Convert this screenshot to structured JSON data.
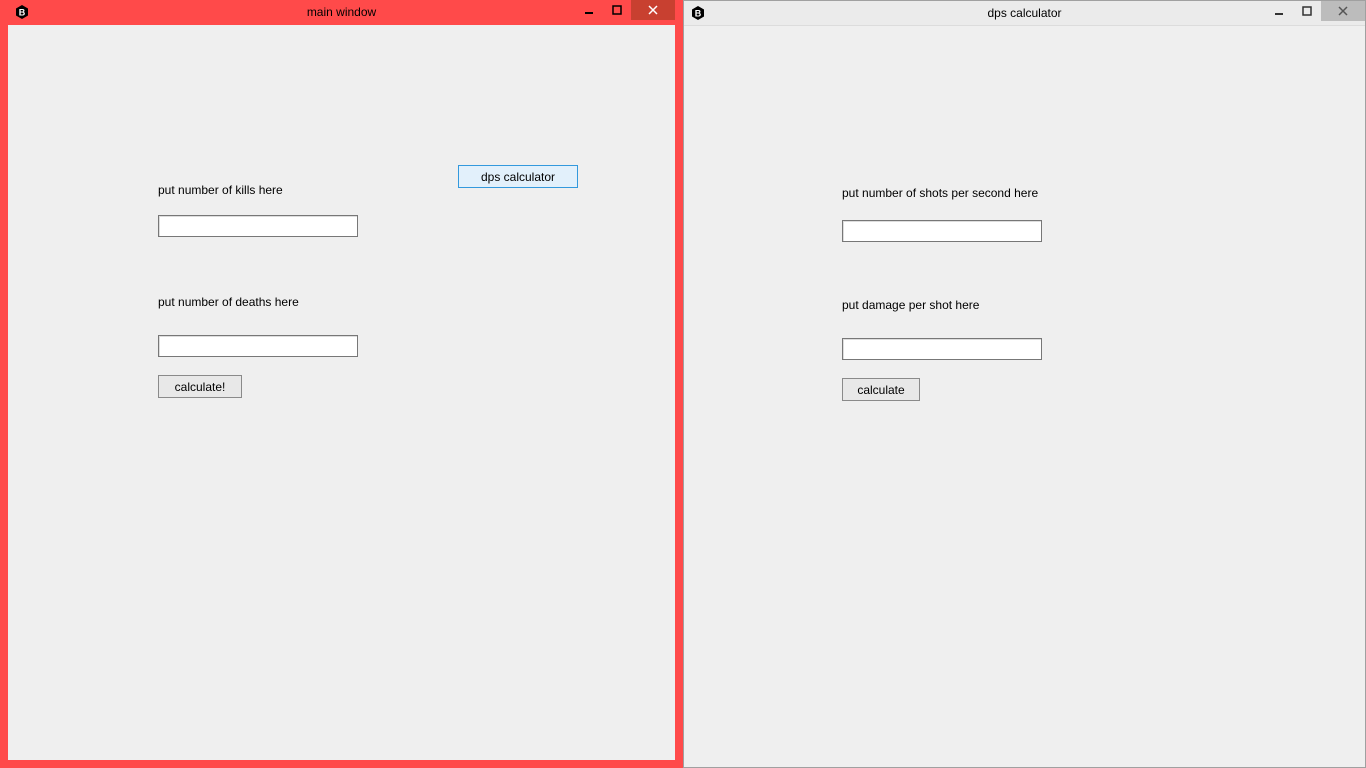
{
  "win1": {
    "title": "main window",
    "labels": {
      "kills": "put number of kills here",
      "deaths": "put number of deaths here"
    },
    "inputs": {
      "kills": "",
      "deaths": ""
    },
    "buttons": {
      "dps_calculator": "dps calculator",
      "calculate": "calculate!"
    }
  },
  "win2": {
    "title": "dps calculator",
    "labels": {
      "shots_per_second": "put number of shots per second here",
      "damage_per_shot": "put damage per shot here"
    },
    "inputs": {
      "shots_per_second": "",
      "damage_per_shot": ""
    },
    "buttons": {
      "calculate": "calculate"
    }
  }
}
